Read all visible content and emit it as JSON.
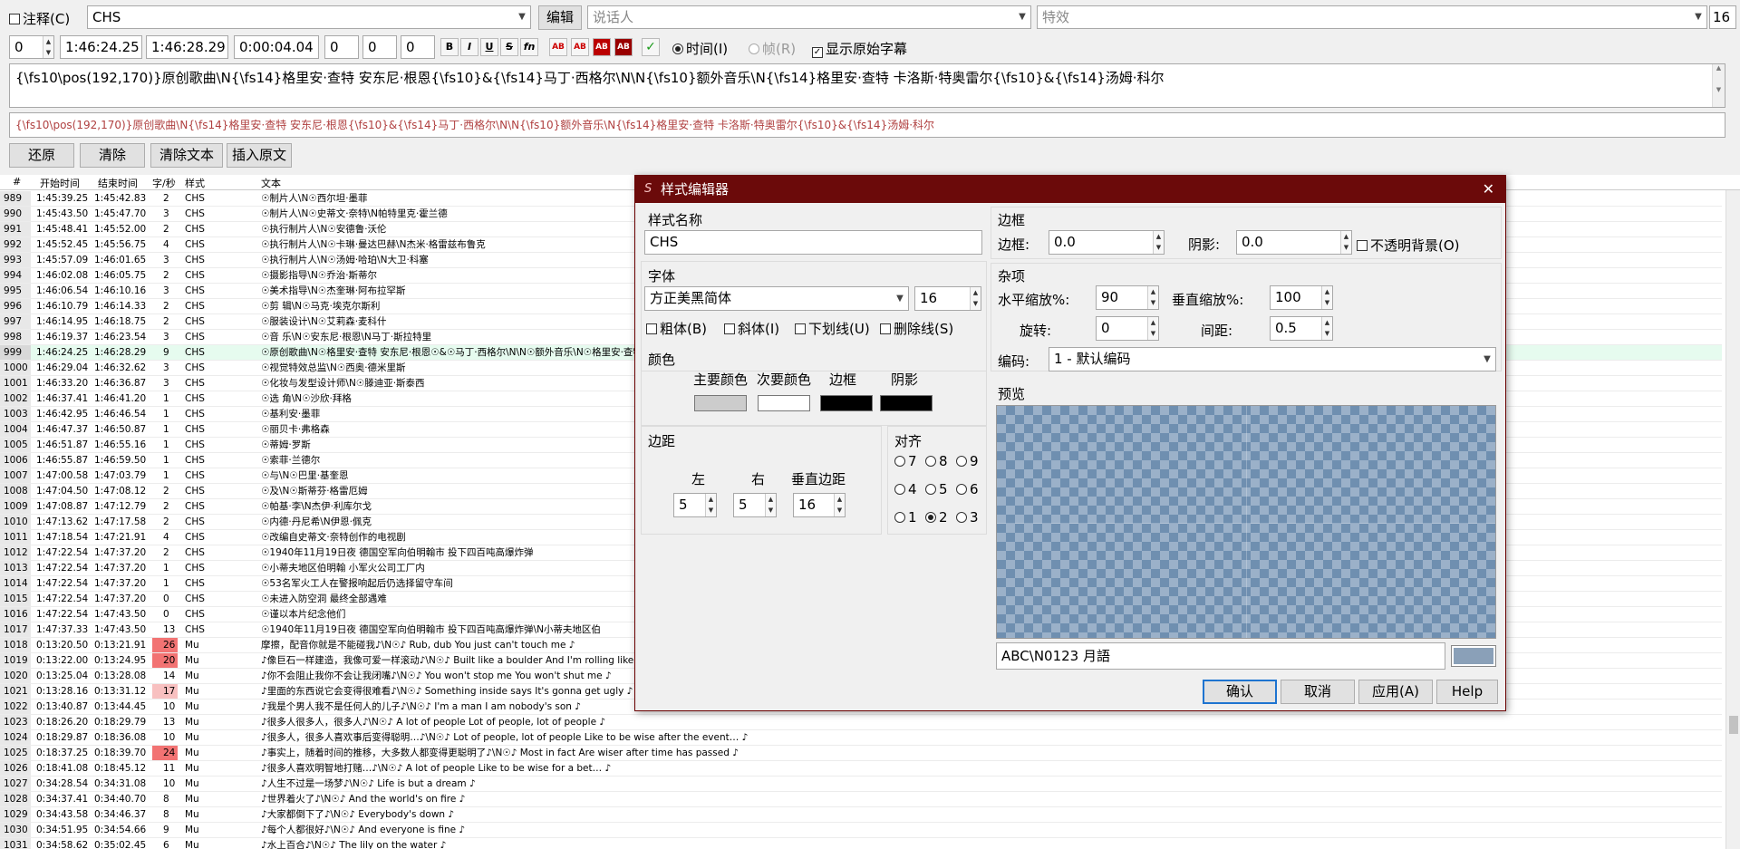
{
  "toolbar": {
    "comment_label": "注释(C)",
    "style_value": "CHS",
    "edit_button": "编辑",
    "actor_placeholder": "说话人",
    "effect_placeholder": "特效",
    "right_value": "16",
    "layer_value": "0",
    "start_time": "1:46:24.25",
    "end_time": "1:46:28.29",
    "duration": "0:00:04.04",
    "margin_l": "0",
    "margin_r": "0",
    "margin_v": "0",
    "format_buttons": [
      "B",
      "I",
      "U",
      "S",
      "fn",
      "AB",
      "AB",
      "AB",
      "AB"
    ],
    "commit_mark": "✓",
    "time_label": "时间(I)",
    "frame_label": "帧(R)",
    "show_original_label": "显示原始字幕"
  },
  "editor": {
    "main_text": "{\\fs10\\pos(192,170)}原创歌曲\\N{\\fs14}格里安·查特 安东尼·根恩{\\fs10}&{\\fs14}马丁·西格尔\\N\\N{\\fs10}额外音乐\\N{\\fs14}格里安·查特 卡洛斯·特奥雷尔{\\fs10}&{\\fs14}汤姆·科尔",
    "original_text": "{\\fs10\\pos(192,170)}原创歌曲\\N{\\fs14}格里安·查特 安东尼·根恩{\\fs10}&{\\fs14}马丁·西格尔\\N\\N{\\fs10}额外音乐\\N{\\fs14}格里安·查特 卡洛斯·特奥雷尔{\\fs10}&{\\fs14}汤姆·科尔",
    "buttons": [
      "还原",
      "清除",
      "清除文本",
      "插入原文"
    ]
  },
  "grid": {
    "headers": [
      "#",
      "开始时间",
      "结束时间",
      "字/秒",
      "样式",
      "文本"
    ],
    "rows": [
      [
        "989",
        "1:45:39.25",
        "1:45:42.83",
        "2",
        "CHS",
        "☉制片人\\N☉西尔坦·墨菲"
      ],
      [
        "990",
        "1:45:43.50",
        "1:45:47.70",
        "3",
        "CHS",
        "☉制片人\\N☉史蒂文·奈特\\N帕特里克·霍兰德"
      ],
      [
        "991",
        "1:45:48.41",
        "1:45:52.00",
        "2",
        "CHS",
        "☉执行制片人\\N☉安德鲁·沃伦"
      ],
      [
        "992",
        "1:45:52.45",
        "1:45:56.75",
        "4",
        "CHS",
        "☉执行制片人\\N☉卡琳·曼达巴赫\\N杰米·格雷兹布鲁克"
      ],
      [
        "993",
        "1:45:57.09",
        "1:46:01.65",
        "3",
        "CHS",
        "☉执行制片人\\N☉汤姆·哈珀\\N大卫·科塞"
      ],
      [
        "994",
        "1:46:02.08",
        "1:46:05.75",
        "2",
        "CHS",
        "☉摄影指导\\N☉乔治·斯蒂尔"
      ],
      [
        "995",
        "1:46:06.54",
        "1:46:10.16",
        "3",
        "CHS",
        "☉美术指导\\N☉杰奎琳·阿布拉罕斯"
      ],
      [
        "996",
        "1:46:10.79",
        "1:46:14.33",
        "2",
        "CHS",
        "☉剪 辑\\N☉马克·埃克尔斯利"
      ],
      [
        "997",
        "1:46:14.95",
        "1:46:18.75",
        "2",
        "CHS",
        "☉服装设计\\N☉艾莉森·麦科什"
      ],
      [
        "998",
        "1:46:19.37",
        "1:46:23.54",
        "3",
        "CHS",
        "☉音 乐\\N☉安东尼·根恩\\N马丁·斯拉特里"
      ],
      [
        "999",
        "1:46:24.25",
        "1:46:28.29",
        "9",
        "CHS",
        "☉原创歌曲\\N☉格里安·查特 安东尼·根恩☉&☉马丁·西格尔\\N\\N☉额外音乐\\N☉格里安·查特 卡洛斯·特奥雷尔☉&☉汤姆·科尔"
      ],
      [
        "1000",
        "1:46:29.04",
        "1:46:32.62",
        "3",
        "CHS",
        "☉视觉特效总监\\N☉西奥·德米里斯"
      ],
      [
        "1001",
        "1:46:33.20",
        "1:46:36.87",
        "3",
        "CHS",
        "☉化妆与发型设计师\\N☉滕迪亚·斯泰西"
      ],
      [
        "1002",
        "1:46:37.41",
        "1:46:41.20",
        "1",
        "CHS",
        "☉选 角\\N☉沙欣·拜格"
      ],
      [
        "1003",
        "1:46:42.95",
        "1:46:46.54",
        "1",
        "CHS",
        "☉基利安·墨菲"
      ],
      [
        "1004",
        "1:46:47.37",
        "1:46:50.87",
        "1",
        "CHS",
        "☉丽贝卡·弗格森"
      ],
      [
        "1005",
        "1:46:51.87",
        "1:46:55.16",
        "1",
        "CHS",
        "☉蒂姆·罗斯"
      ],
      [
        "1006",
        "1:46:55.87",
        "1:46:59.50",
        "1",
        "CHS",
        "☉索菲·兰德尔"
      ],
      [
        "1007",
        "1:47:00.58",
        "1:47:03.79",
        "1",
        "CHS",
        "☉与\\N☉巴里·基奎恩"
      ],
      [
        "1008",
        "1:47:04.50",
        "1:47:08.12",
        "2",
        "CHS",
        "☉及\\N☉斯蒂芬·格雷厄姆"
      ],
      [
        "1009",
        "1:47:08.87",
        "1:47:12.79",
        "2",
        "CHS",
        "☉帕基·李\\N杰伊·利库尔戈"
      ],
      [
        "1010",
        "1:47:13.62",
        "1:47:17.58",
        "2",
        "CHS",
        "☉内德·丹尼希\\N伊恩·佩克"
      ],
      [
        "1011",
        "1:47:18.54",
        "1:47:21.91",
        "4",
        "CHS",
        "☉改编自史蒂文·奈特创作的电视剧"
      ],
      [
        "1012",
        "1:47:22.54",
        "1:47:37.20",
        "2",
        "CHS",
        "☉1940年11月19日夜 德国空军向伯明翰市 投下四百吨高爆炸弹"
      ],
      [
        "1013",
        "1:47:22.54",
        "1:47:37.20",
        "1",
        "CHS",
        "☉小蒂夫地区伯明翰 小军火公司工厂内"
      ],
      [
        "1014",
        "1:47:22.54",
        "1:47:37.20",
        "1",
        "CHS",
        "☉53名军火工人在警报响起后仍选择留守车间"
      ],
      [
        "1015",
        "1:47:22.54",
        "1:47:37.20",
        "0",
        "CHS",
        "☉未进入防空洞 最终全部遇难"
      ],
      [
        "1016",
        "1:47:22.54",
        "1:47:43.50",
        "0",
        "CHS",
        "☉谨以本片纪念他们"
      ],
      [
        "1017",
        "1:47:37.33",
        "1:47:43.50",
        "13",
        "CHS",
        "☉1940年11月19日夜 德国空军向伯明翰市 投下四百吨高爆炸弹\\N小蒂夫地区伯"
      ],
      [
        "1018",
        "0:13:20.50",
        "0:13:21.91",
        "26",
        "Mu",
        "摩擦，配音你就是不能碰我♪\\N☉♪ Rub, dub You just can't touch me ♪"
      ],
      [
        "1019",
        "0:13:22.00",
        "0:13:24.95",
        "20",
        "Mu",
        "♪像巨石一样建造，我像可爱一样滚动♪\\N☉♪ Built like a boulder And I'm rolling like"
      ],
      [
        "1020",
        "0:13:25.04",
        "0:13:28.08",
        "14",
        "Mu",
        "♪你不会阻止我你不会让我闭嘴♪\\N☉♪ You won't stop me You won't shut me ♪"
      ],
      [
        "1021",
        "0:13:28.16",
        "0:13:31.12",
        "17",
        "Mu",
        "♪里面的东西说它会变得很难看♪\\N☉♪ Something inside says It's gonna get ugly ♪"
      ],
      [
        "1022",
        "0:13:40.87",
        "0:13:44.45",
        "10",
        "Mu",
        "♪我是个男人我不是任何人的儿子♪\\N☉♪ I'm a man I am nobody's son ♪"
      ],
      [
        "1023",
        "0:18:26.20",
        "0:18:29.79",
        "13",
        "Mu",
        "♪很多人很多人，很多人♪\\N☉♪ A lot of people Lot of people, lot of people ♪"
      ],
      [
        "1024",
        "0:18:29.87",
        "0:18:36.08",
        "10",
        "Mu",
        "♪很多人，很多人喜欢事后变得聪明…♪\\N☉♪ Lot of people, lot of people Like to be wise after the event… ♪"
      ],
      [
        "1025",
        "0:18:37.25",
        "0:18:39.70",
        "24",
        "Mu",
        "♪事实上，随着时间的推移，大多数人都变得更聪明了♪\\N☉♪ Most in fact Are wiser after time has passed ♪"
      ],
      [
        "1026",
        "0:18:41.08",
        "0:18:45.12",
        "11",
        "Mu",
        "♪很多人喜欢明智地打赌…♪\\N☉♪ A lot of people Like to be wise for a bet… ♪"
      ],
      [
        "1027",
        "0:34:28.54",
        "0:34:31.08",
        "10",
        "Mu",
        "♪人生不过是一场梦♪\\N☉♪ Life is but a dream ♪"
      ],
      [
        "1028",
        "0:34:37.41",
        "0:34:40.70",
        "8",
        "Mu",
        "♪世界着火了♪\\N☉♪ And the world's on fire ♪"
      ],
      [
        "1029",
        "0:34:43.58",
        "0:34:46.37",
        "8",
        "Mu",
        "♪大家都倒下了♪\\N☉♪ Everybody's down ♪"
      ],
      [
        "1030",
        "0:34:51.95",
        "0:34:54.66",
        "9",
        "Mu",
        "♪每个人都很好♪\\N☉♪ And everyone is fine ♪"
      ],
      [
        "1031",
        "0:34:58.62",
        "0:35:02.45",
        "6",
        "Mu",
        "♪水上百合♪\\N☉♪ The lily on the water ♪"
      ]
    ]
  },
  "dialog": {
    "title": "样式编辑器",
    "close_glyph": "✕",
    "style_name_label": "样式名称",
    "style_name_value": "CHS",
    "font_label": "字体",
    "font_name": "方正美黑简体",
    "font_size": "16",
    "bold_label": "粗体(B)",
    "italic_label": "斜体(I)",
    "underline_label": "下划线(U)",
    "strike_label": "删除线(S)",
    "color_label": "颜色",
    "primary_label": "主要颜色",
    "secondary_label": "次要颜色",
    "outline_label": "边框",
    "shadow_label": "阴影",
    "colors": {
      "primary": "#cccccc",
      "secondary": "#ffffff",
      "outline": "#000000",
      "shadow": "#000000"
    },
    "margin_label": "边距",
    "margin_left_label": "左",
    "margin_right_label": "右",
    "margin_vert_label": "垂直边距",
    "margin_left": "5",
    "margin_right": "5",
    "margin_vert": "16",
    "align_label": "对齐",
    "align_options": [
      "7",
      "8",
      "9",
      "4",
      "5",
      "6",
      "1",
      "2",
      "3"
    ],
    "border_group_label": "边框",
    "border_label": "边框:",
    "border_value": "0.0",
    "shadow_field_label": "阴影:",
    "shadow_value": "0.0",
    "opaque_label": "不透明背景(O)",
    "misc_label": "杂项",
    "scale_x_label": "水平缩放%:",
    "scale_x": "90",
    "scale_y_label": "垂直缩放%:",
    "scale_y": "100",
    "rotation_label": "旋转:",
    "rotation": "0",
    "spacing_label": "间距:",
    "spacing": "0.5",
    "encoding_label": "编码:",
    "encoding_value": "1 - 默认编码",
    "preview_label": "预览",
    "preview_text": "ABC\\N0123 月語",
    "preview_bg_color": "#8aa0b8",
    "ok": "确认",
    "cancel": "取消",
    "apply": "应用(A)",
    "help": "Help"
  }
}
